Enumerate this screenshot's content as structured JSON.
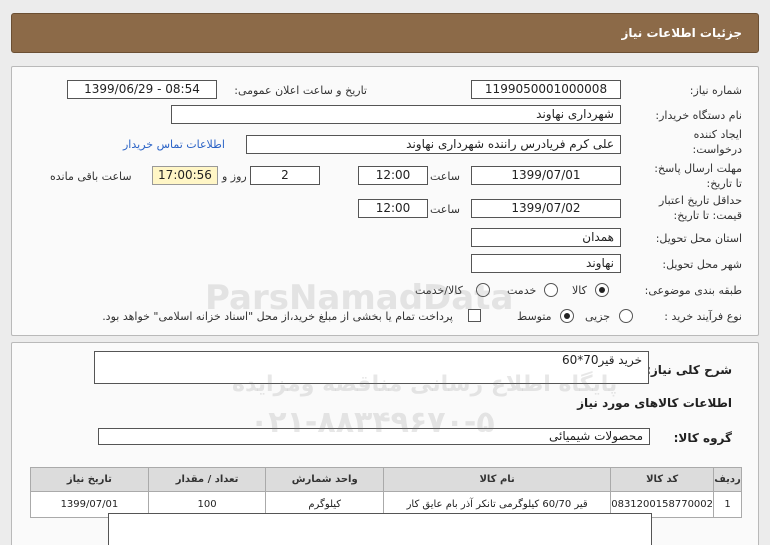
{
  "header": {
    "title": "جزئیات اطلاعات نیاز"
  },
  "details": {
    "need_number": {
      "label": "شماره نیاز:",
      "value": "1199050001000008"
    },
    "announce_datetime": {
      "label": "تاریخ و ساعت اعلان عمومی:",
      "value": "1399/06/29 - 08:54"
    },
    "buyer_org": {
      "label": "نام دستگاه خریدار:",
      "value": "شهرداری نهاوند"
    },
    "requester": {
      "label_line1": "ایجاد کننده",
      "label_line2": "درخواست:",
      "value": "علی کرم فریادرس راننده شهرداری نهاوند",
      "contact_link": "اطلاعات تماس خریدار"
    },
    "response_deadline": {
      "label_line1": "مهلت ارسال پاسخ:",
      "label_line2": "تا تاریخ:",
      "date": "1399/07/01",
      "time_label": "ساعت",
      "time": "12:00",
      "days_value": "2",
      "days_label": "روز و",
      "remaining_time": "17:00:56",
      "remaining_label": "ساعت باقی مانده"
    },
    "price_validity": {
      "label_line1": "حداقل تاریخ اعتبار",
      "label_line2": "قیمت: تا تاریخ:",
      "date": "1399/07/02",
      "time_label": "ساعت",
      "time": "12:00"
    },
    "province": {
      "label": "استان محل تحویل:",
      "value": "همدان"
    },
    "city": {
      "label": "شهر محل تحویل:",
      "value": "نهاوند"
    },
    "category": {
      "label": "طبقه بندی موضوعی:",
      "options": [
        "کالا",
        "خدمت",
        "کالا/خدمت"
      ],
      "selected": "کالا"
    },
    "purchase_process": {
      "label": "نوع فرآیند خرید :",
      "options": [
        "جزیی",
        "متوسط"
      ],
      "selected": "متوسط",
      "payment_note": "پرداخت تمام یا بخشی از مبلغ خرید،از محل \"اسناد خزانه اسلامی\" خواهد بود."
    }
  },
  "items_section": {
    "summary_label": "شرح کلی نیاز:",
    "summary_value": "خرید قیر70*60",
    "goods_info_title": "اطلاعات کالاهای مورد نیاز",
    "goods_group_label": "گروه کالا:",
    "goods_group_value": "محصولات شیمیائی",
    "table": {
      "headers": [
        "ردیف",
        "کد کالا",
        "نام کالا",
        "واحد شمارش",
        "تعداد / مقدار",
        "تاریخ نیاز"
      ],
      "rows": [
        [
          "1",
          "0831200158770002",
          "قیر 60/70 کیلوگرمی تانکر آذر بام عایق کار",
          "کیلوگرم",
          "100",
          "1399/07/01"
        ]
      ]
    }
  },
  "watermark": {
    "line1": "ParsNamadData",
    "line2": "پایگاه اطلاع رسانی مناقصه ومزایده",
    "line3": "۰۲۱-۸۸۳۴۹۶۷۰-۵"
  }
}
